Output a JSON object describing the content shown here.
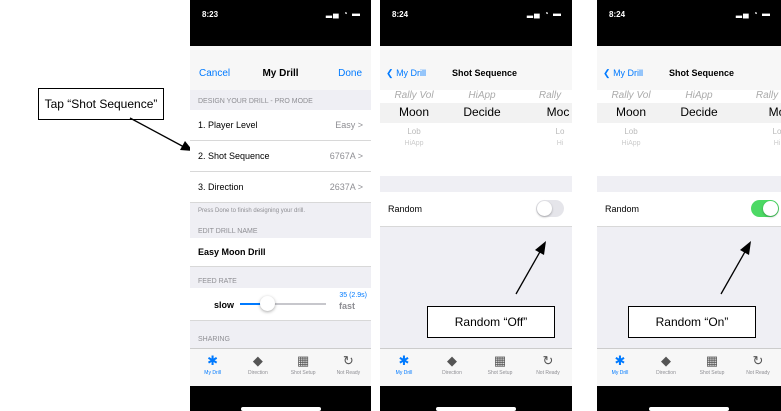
{
  "callout_tap": "Tap “Shot Sequence”",
  "callout_off": "Random “Off”",
  "callout_on": "Random “On”",
  "phone1": {
    "time": "8:23",
    "status_icons": "▂▄ ◔ ▬",
    "nav": {
      "cancel": "Cancel",
      "title": "My Drill",
      "done": "Done"
    },
    "section_design": "DESIGN YOUR DRILL - PRO MODE",
    "rows": [
      {
        "label": "1. Player Level",
        "value": "Easy"
      },
      {
        "label": "2. Shot Sequence",
        "value": "6767A"
      },
      {
        "label": "3. Direction",
        "value": "2637A"
      }
    ],
    "hint": "Press Done to finish designing your drill.",
    "section_name": "EDIT DRILL NAME",
    "drill_name": "Easy Moon Drill",
    "section_feed": "FEED RATE",
    "feed": {
      "slow": "slow",
      "fast": "fast",
      "value": "35 (2.9s)",
      "fraction": 0.33
    },
    "section_sharing": "SHARING"
  },
  "phone2": {
    "time": "8:24",
    "nav_back": "My Drill",
    "nav_title": "Shot Sequence",
    "picker_top": [
      "Rally Vol",
      "HiApp",
      "Rally"
    ],
    "picker_selected": [
      "Moon",
      "Decide",
      "Moc"
    ],
    "picker_below1": [
      "Lob",
      "",
      "Lo"
    ],
    "picker_below2": [
      "HiApp",
      "",
      "Hi"
    ],
    "random_label": "Random",
    "random_on": false
  },
  "phone3": {
    "time": "8:24",
    "nav_back": "My Drill",
    "nav_title": "Shot Sequence",
    "picker_top": [
      "Rally Vol",
      "HiApp",
      "Rally"
    ],
    "picker_selected": [
      "Moon",
      "Decide",
      "Mo"
    ],
    "picker_below1": [
      "Lob",
      "",
      "Lo"
    ],
    "picker_below2": [
      "HiApp",
      "",
      "Hi"
    ],
    "random_label": "Random",
    "random_on": true
  },
  "tabs": [
    {
      "label": "My Drill",
      "icon": "drill-icon"
    },
    {
      "label": "Direction",
      "icon": "direction-icon"
    },
    {
      "label": "Shot Setup",
      "icon": "sliders-icon"
    },
    {
      "label": "Not Ready",
      "icon": "refresh-icon"
    }
  ],
  "colors": {
    "ios_blue": "#007aff",
    "toggle_on": "#4cd964",
    "toggle_off": "#e5e5ea"
  }
}
